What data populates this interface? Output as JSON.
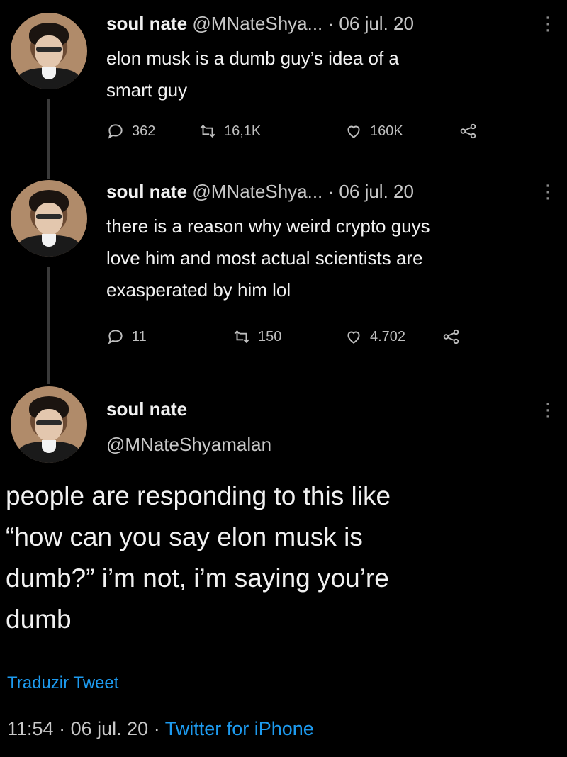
{
  "tweets": [
    {
      "name": "soul nate",
      "handle": "@MNateShya...",
      "dot": "·",
      "date": "06 jul. 20",
      "text_line1": "elon musk is a dumb guy’s idea of a",
      "text_line2": "smart guy",
      "replies": "362",
      "retweets": "16,1K",
      "likes": "160K"
    },
    {
      "name": "soul nate",
      "handle": "@MNateShya...",
      "dot": "·",
      "date": "06 jul. 20",
      "text_line1": "there is a reason why weird crypto guys",
      "text_line2": "love him and most actual scientists are",
      "text_line3": "exasperated by him lol",
      "replies": "11",
      "retweets": "150",
      "likes": "4.702"
    }
  ],
  "main": {
    "name": "soul nate",
    "handle": "@MNateShyamalan",
    "body_line1": "people are responding to this like",
    "body_line2": "“how can you say elon musk is",
    "body_line3": "dumb?” i’m not, i’m saying you’re",
    "body_line4": "dumb",
    "translate": "Traduzir Tweet",
    "time": "11:54",
    "sep": "·",
    "date": "06 jul. 20",
    "client": "Twitter for iPhone"
  },
  "colors": {
    "background": "#000000",
    "link": "#1d9bf0",
    "text": "#f1f1f1"
  },
  "icons": [
    "more-vertical-icon",
    "reply-icon",
    "retweet-icon",
    "like-icon",
    "share-icon"
  ]
}
